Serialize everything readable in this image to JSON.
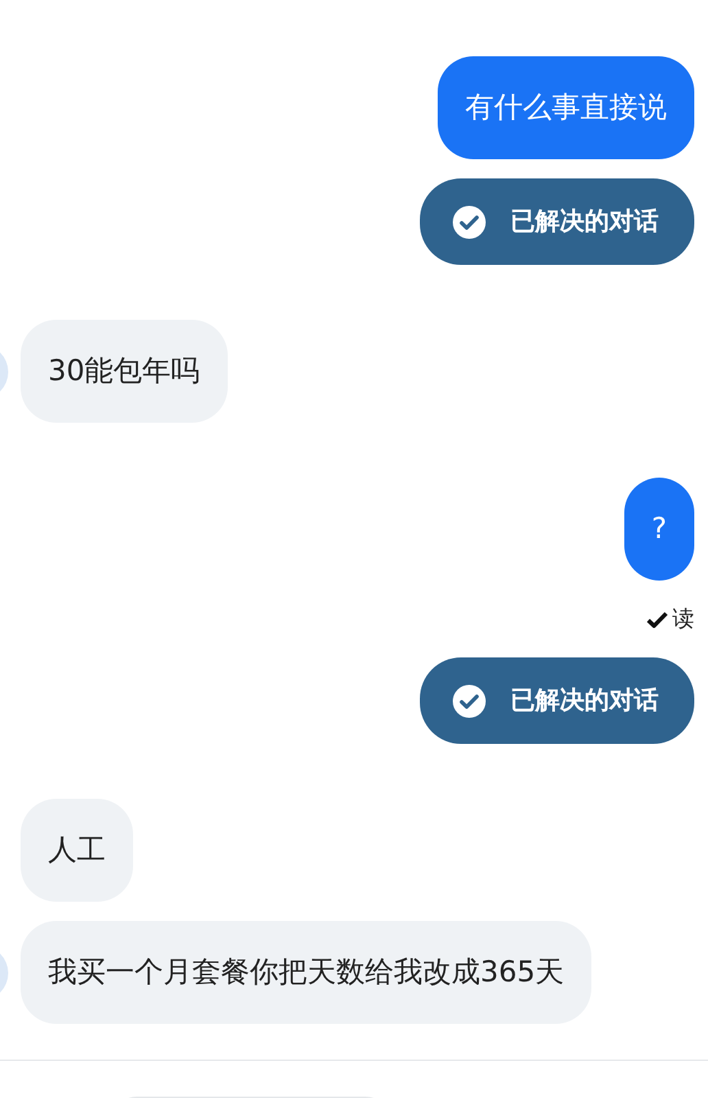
{
  "messages": [
    {
      "kind": "outgoing",
      "text": "有什么事直接说"
    },
    {
      "kind": "resolved",
      "text": "已解决的对话"
    },
    {
      "kind": "incoming",
      "text": "30能包年吗",
      "avatar": true
    },
    {
      "kind": "outgoing",
      "text": "?"
    },
    {
      "kind": "receipt",
      "text": "读"
    },
    {
      "kind": "resolved",
      "text": "已解决的对话"
    },
    {
      "kind": "incoming",
      "text": "人工",
      "avatar": false
    },
    {
      "kind": "incoming",
      "text": "我买一个月套餐你把天数给我改成365天",
      "avatar": true
    }
  ],
  "composer": {
    "kind": "field"
  }
}
